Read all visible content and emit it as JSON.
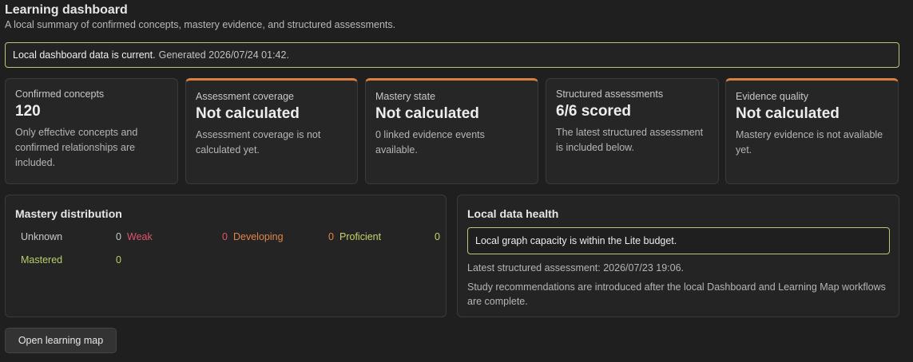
{
  "header": {
    "title": "Learning dashboard",
    "subtitle": "A local summary of confirmed concepts, mastery evidence, and structured assessments."
  },
  "status": {
    "strong": "Local dashboard data is current.",
    "generated": "Generated 2026/07/24 01:42."
  },
  "cards": [
    {
      "label": "Confirmed concepts",
      "value": "120",
      "desc": "Only effective concepts and confirmed relationships are included."
    },
    {
      "label": "Assessment coverage",
      "value": "Not calculated",
      "desc": "Assessment coverage is not calculated yet."
    },
    {
      "label": "Mastery state",
      "value": "Not calculated",
      "desc": "0 linked evidence events available."
    },
    {
      "label": "Structured assessments",
      "value": "6/6 scored",
      "desc": "The latest structured assessment is included below."
    },
    {
      "label": "Evidence quality",
      "value": "Not calculated",
      "desc": "Mastery evidence is not available yet."
    }
  ],
  "distribution": {
    "title": "Mastery distribution",
    "items": [
      {
        "name": "Unknown",
        "count": "0",
        "color": "#c8c8c8"
      },
      {
        "name": "Weak",
        "count": "0",
        "color": "#e0536a"
      },
      {
        "name": "Developing",
        "count": "0",
        "color": "#e0844a"
      },
      {
        "name": "Proficient",
        "count": "0",
        "color": "#c9d36a"
      },
      {
        "name": "Mastered",
        "count": "0",
        "color": "#b6cf6a"
      }
    ]
  },
  "health": {
    "title": "Local data health",
    "capacity": "Local graph capacity is within the Lite budget.",
    "latest": "Latest structured assessment: 2026/07/23 19:06.",
    "note": "Study recommendations are introduced after the local Dashboard and Learning Map workflows are complete."
  },
  "actions": {
    "open_map": "Open learning map"
  },
  "colors": {
    "accent": "#d9803f",
    "banner_border": "#b9c77a"
  }
}
